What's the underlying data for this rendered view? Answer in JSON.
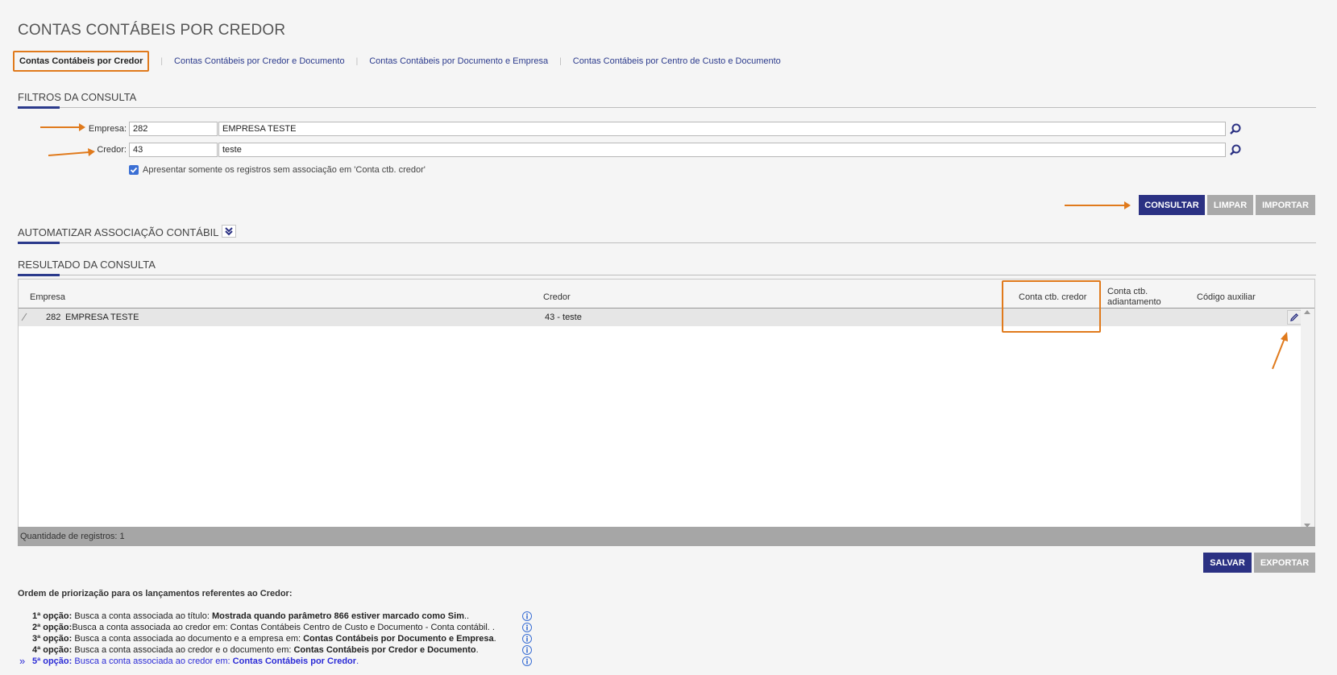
{
  "page": {
    "title": "CONTAS CONTÁBEIS POR CREDOR"
  },
  "tabs": [
    {
      "label": "Contas Contábeis por Credor",
      "active": true
    },
    {
      "label": "Contas Contábeis por Credor e Documento"
    },
    {
      "label": "Contas Contábeis por Documento e Empresa"
    },
    {
      "label": "Contas Contábeis por Centro de Custo e Documento"
    }
  ],
  "tab_separator": "|",
  "filters": {
    "title": "FILTROS DA CONSULTA",
    "empresa_label": "Empresa:",
    "empresa_code": "282",
    "empresa_name": "EMPRESA TESTE",
    "credor_label": "Credor:",
    "credor_code": "43",
    "credor_name": "teste",
    "checkbox_label": "Apresentar somente os registros sem associação em 'Conta ctb. credor'",
    "checkbox_checked": true
  },
  "actions": {
    "consultar": "CONSULTAR",
    "limpar": "LIMPAR",
    "importar": "IMPORTAR"
  },
  "automatizar": {
    "title": "AUTOMATIZAR ASSOCIAÇÃO CONTÁBIL"
  },
  "result": {
    "title": "RESULTADO DA CONSULTA",
    "columns": {
      "empresa": "Empresa",
      "credor": "Credor",
      "conta_credor": "Conta ctb. credor",
      "conta_adiantamento_1": "Conta ctb.",
      "conta_adiantamento_2": "adiantamento",
      "codigo_auxiliar": "Código auxiliar"
    },
    "rows": [
      {
        "empresa_code": "282",
        "empresa_name": "EMPRESA TESTE",
        "credor": "43 - teste",
        "conta_credor": "",
        "conta_adiantamento": "",
        "codigo_auxiliar": ""
      }
    ],
    "footer": "Quantidade de registros: 1"
  },
  "bottom_actions": {
    "salvar": "SALVAR",
    "exportar": "EXPORTAR"
  },
  "priority": {
    "title": "Ordem de priorização para os lançamentos referentes ao Credor:",
    "options": [
      {
        "prefix": "1ª opção:",
        "text": " Busca a conta associada ao título: ",
        "bold": "Mostrada quando parâmetro 866 estiver marcado como Sim",
        "suffix": ".."
      },
      {
        "prefix": "2ª opção:",
        "text": "Busca a conta associada ao credor em: Contas Contábeis Centro de Custo e Documento - Conta contábil. .",
        "bold": "",
        "suffix": ""
      },
      {
        "prefix": "3ª opção:",
        "text": " Busca a conta associada ao documento e a empresa em: ",
        "bold": "Contas Contábeis por Documento e Empresa",
        "suffix": "."
      },
      {
        "prefix": "4ª opção:",
        "text": " Busca a conta associada ao credor e o documento em: ",
        "bold": "Contas Contábeis por Credor e Documento",
        "suffix": "."
      },
      {
        "prefix": "5ª opção:",
        "text": " Busca a conta associada ao credor em: ",
        "bold": "Contas Contábeis por Credor",
        "suffix": "."
      }
    ],
    "current_marker": "»"
  },
  "colors": {
    "accent": "#2b3183",
    "highlight": "#e07a1c",
    "disabled": "#a9a9a9"
  }
}
